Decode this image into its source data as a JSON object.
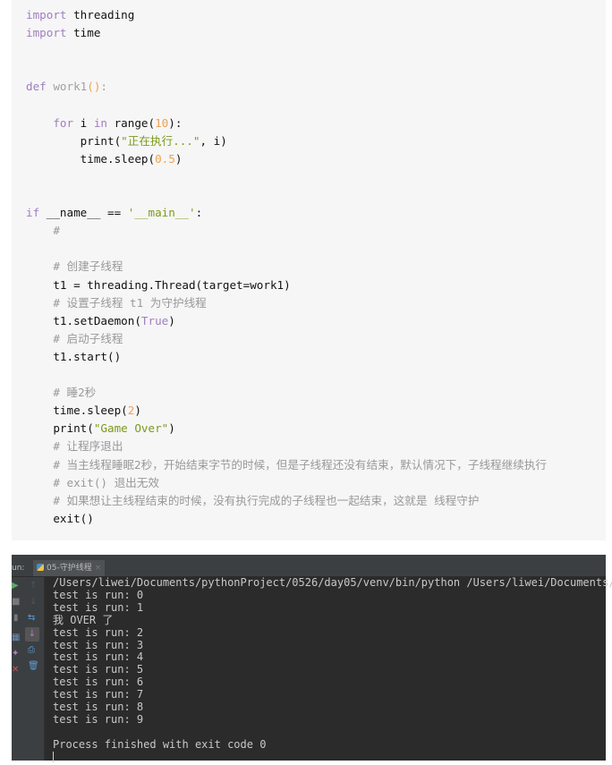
{
  "code_lines": [
    [
      [
        "import",
        "kw"
      ],
      [
        " threading",
        ""
      ]
    ],
    [
      [
        "import",
        "kw"
      ],
      [
        " time",
        ""
      ]
    ],
    [],
    [],
    [
      [
        "def",
        "kw"
      ],
      [
        " work1",
        "fn"
      ],
      [
        "()",
        "par"
      ],
      [
        ":",
        "fn"
      ]
    ],
    [],
    [
      [
        "    ",
        ""
      ],
      [
        "for",
        "kw"
      ],
      [
        " i ",
        ""
      ],
      [
        "in",
        "kw"
      ],
      [
        " range(",
        ""
      ],
      [
        "10",
        "num"
      ],
      [
        "):",
        ""
      ]
    ],
    [
      [
        "        print(",
        ""
      ],
      [
        "\"正在执行...\"",
        "str"
      ],
      [
        ", i)",
        ""
      ]
    ],
    [
      [
        "        time.sleep(",
        ""
      ],
      [
        "0.5",
        "num"
      ],
      [
        ")",
        ""
      ]
    ],
    [],
    [],
    [
      [
        "if",
        "kw"
      ],
      [
        " __name__ == ",
        ""
      ],
      [
        "'__main__'",
        "str"
      ],
      [
        ":",
        ""
      ]
    ],
    [
      [
        "    #",
        "cm"
      ]
    ],
    [],
    [
      [
        "    # 创建子线程",
        "cm"
      ]
    ],
    [
      [
        "    t1 = threading.Thread(target=work1)",
        ""
      ]
    ],
    [
      [
        "    # 设置子线程 t1 为守护线程",
        "cm"
      ]
    ],
    [
      [
        "    t1.setDaemon(",
        ""
      ],
      [
        "True",
        "kw"
      ],
      [
        ")",
        ""
      ]
    ],
    [
      [
        "    # 启动子线程",
        "cm"
      ]
    ],
    [
      [
        "    t1.start()",
        ""
      ]
    ],
    [],
    [
      [
        "    # 睡2秒",
        "cm"
      ]
    ],
    [
      [
        "    time.sleep(",
        ""
      ],
      [
        "2",
        "num"
      ],
      [
        ")",
        ""
      ]
    ],
    [
      [
        "    print(",
        ""
      ],
      [
        "\"Game Over\"",
        "str"
      ],
      [
        ")",
        ""
      ]
    ],
    [
      [
        "    # 让程序退出",
        "cm"
      ]
    ],
    [
      [
        "    # 当主线程睡眠2秒，开始结束字节的时候，但是子线程还没有结束，默认情况下，子线程继续执行",
        "cm"
      ]
    ],
    [
      [
        "    # exit() 退出无效",
        "cm"
      ]
    ],
    [
      [
        "    # 如果想让主线程结束的时候，没有执行完成的子线程也一起结束，这就是 线程守护",
        "cm"
      ]
    ],
    [
      [
        "    exit()",
        ""
      ]
    ]
  ],
  "run": {
    "label": "un:",
    "tab": "05-守护线程",
    "tab_close": "×",
    "output": [
      "/Users/liwei/Documents/pythonProject/0526/day05/venv/bin/python /Users/liwei/Documents/",
      "test is run: 0",
      "test is run: 1",
      "我 OVER 了",
      "test is run: 2",
      "test is run: 3",
      "test is run: 4",
      "test is run: 5",
      "test is run: 6",
      "test is run: 7",
      "test is run: 8",
      "test is run: 9",
      "",
      "Process finished with exit code 0"
    ]
  }
}
